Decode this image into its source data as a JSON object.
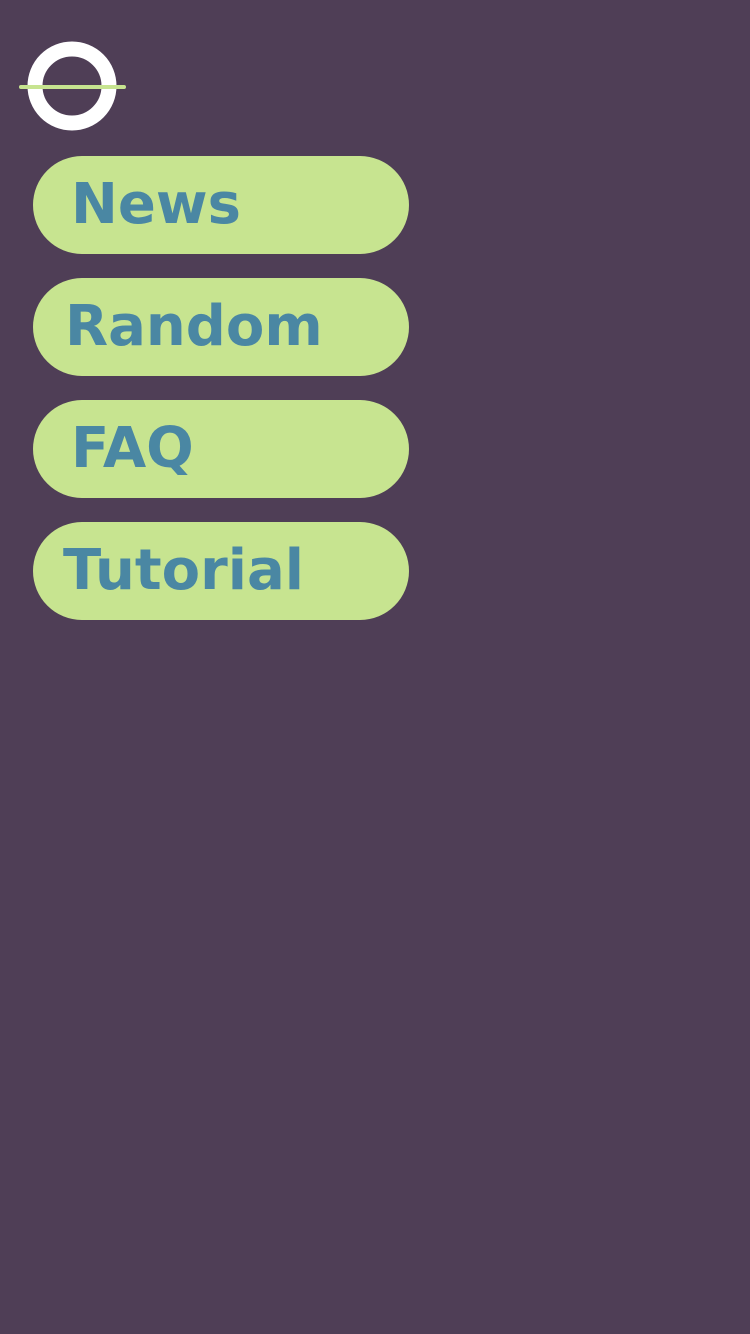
{
  "colors": {
    "background": "#4f3e56",
    "button_fill": "#c7e490",
    "button_text": "#4a87a3",
    "logo_ring": "#ffffff",
    "logo_line": "#c7e490"
  },
  "logo": {
    "icon": "ring-with-horizontal-line-logo"
  },
  "menu": {
    "items": [
      {
        "label": "News"
      },
      {
        "label": "Random"
      },
      {
        "label": "FAQ"
      },
      {
        "label": "Tutorial"
      }
    ]
  }
}
